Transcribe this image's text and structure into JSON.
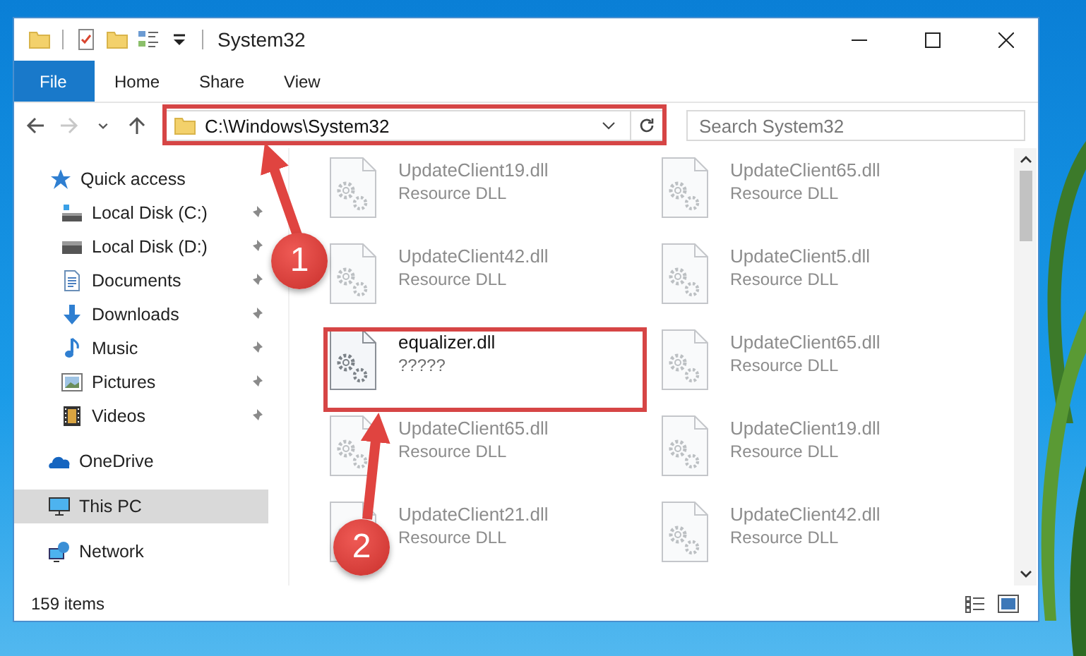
{
  "window": {
    "title": "System32"
  },
  "quick_access_toolbar": [
    {
      "kind": "folder"
    },
    {
      "kind": "properties"
    },
    {
      "kind": "new-folder"
    },
    {
      "kind": "view"
    }
  ],
  "ribbon_tabs": [
    {
      "label": "File",
      "kind": "file"
    },
    {
      "label": "Home",
      "kind": "tab"
    },
    {
      "label": "Share",
      "kind": "tab"
    },
    {
      "label": "View",
      "kind": "tab"
    }
  ],
  "navigation": {
    "back_disabled": false,
    "forward_disabled": true
  },
  "address_bar": {
    "value": "C:\\Windows\\System32"
  },
  "search": {
    "placeholder": "Search System32"
  },
  "sidebar": {
    "items": [
      {
        "label": "Quick access",
        "kind": "star",
        "selected": false,
        "children": [
          {
            "label": "Local Disk (C:)",
            "kind": "drive-c",
            "pinned": true,
            "selected": false
          },
          {
            "label": "Local Disk (D:)",
            "kind": "drive",
            "pinned": true,
            "selected": false
          },
          {
            "label": "Documents",
            "kind": "document",
            "pinned": true,
            "selected": false
          },
          {
            "label": "Downloads",
            "kind": "download",
            "pinned": true,
            "selected": false
          },
          {
            "label": "Music",
            "kind": "music",
            "pinned": true,
            "selected": false
          },
          {
            "label": "Pictures",
            "kind": "pictures",
            "pinned": true,
            "selected": false
          },
          {
            "label": "Videos",
            "kind": "videos",
            "pinned": true,
            "selected": false
          }
        ]
      },
      {
        "label": "OneDrive",
        "kind": "cloud",
        "selected": false
      },
      {
        "label": "This PC",
        "kind": "computer",
        "selected": true
      },
      {
        "label": "Network",
        "kind": "network",
        "selected": false
      }
    ]
  },
  "files": [
    {
      "name": "UpdateClient19.dll",
      "type": "Resource DLL",
      "blurred": true
    },
    {
      "name": "UpdateClient65.dll",
      "type": "Resource DLL",
      "blurred": true
    },
    {
      "name": "UpdateClient42.dll",
      "type": "Resource DLL",
      "blurred": true
    },
    {
      "name": "UpdateClient5.dll",
      "type": "Resource DLL",
      "blurred": true
    },
    {
      "name": "equalizer.dll",
      "type": "?????",
      "blurred": false
    },
    {
      "name": "UpdateClient65.dll",
      "type": "Resource DLL",
      "blurred": true
    },
    {
      "name": "UpdateClient65.dll",
      "type": "Resource DLL",
      "blurred": true
    },
    {
      "name": "UpdateClient19.dll",
      "type": "Resource DLL",
      "blurred": true
    },
    {
      "name": "UpdateClient21.dll",
      "type": "Resource DLL",
      "blurred": true
    },
    {
      "name": "UpdateClient42.dll",
      "type": "Resource DLL",
      "blurred": true
    }
  ],
  "status_bar": {
    "item_count": "159 items",
    "view_modes": [
      {
        "kind": "details",
        "selected": false
      },
      {
        "kind": "large-icons",
        "selected": false
      }
    ]
  },
  "annotations": [
    {
      "label": "1"
    },
    {
      "label": "2"
    }
  ]
}
